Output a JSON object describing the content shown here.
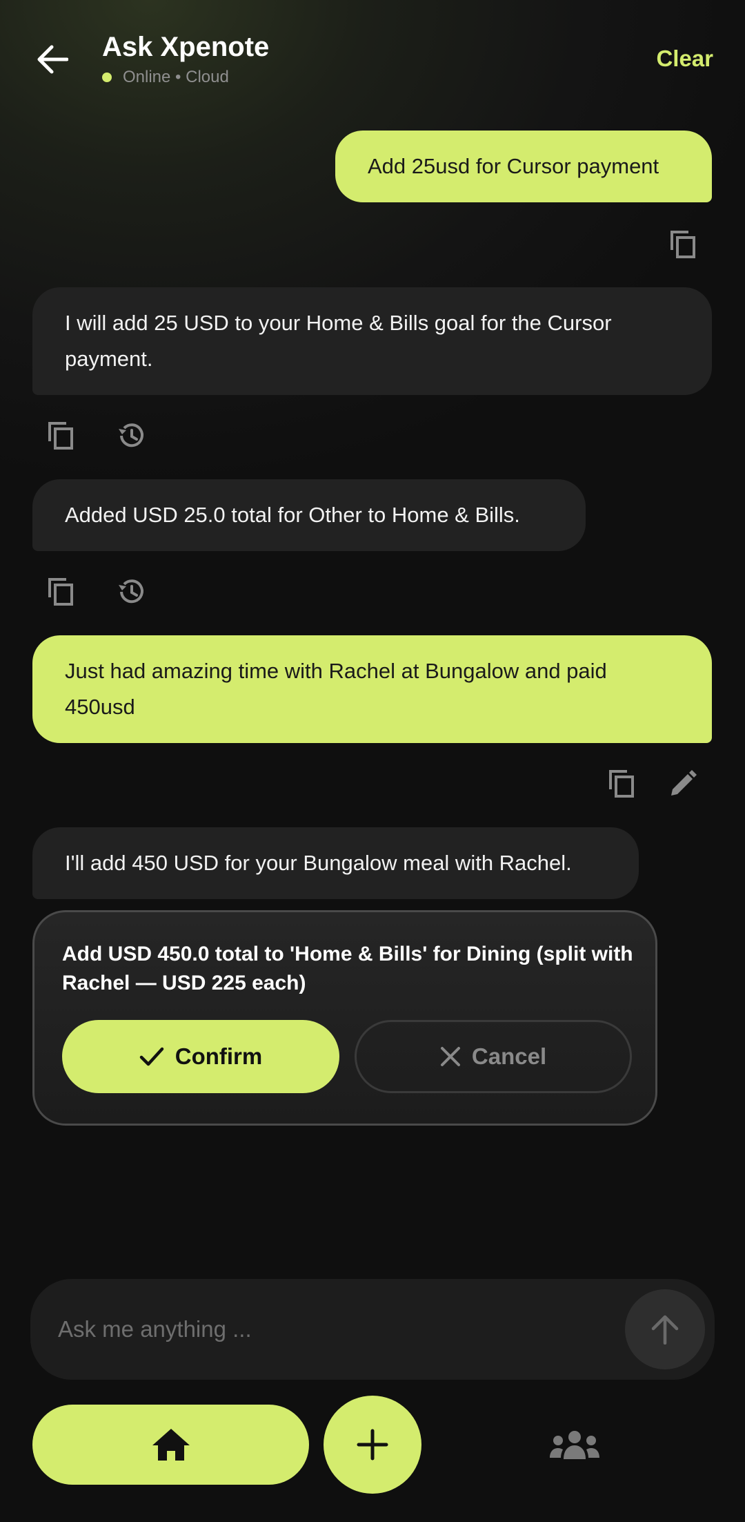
{
  "header": {
    "title": "Ask Xpenote",
    "status": "Online • Cloud",
    "clear_label": "Clear"
  },
  "messages": [
    {
      "role": "user",
      "text": "Add 25usd for Cursor payment"
    },
    {
      "role": "assistant",
      "text": "I will add 25 USD to your Home & Bills goal for the Cursor payment."
    },
    {
      "role": "assistant",
      "text": "Added USD 25.0 total for Other to Home & Bills."
    },
    {
      "role": "user",
      "text": "Just had amazing time with Rachel at Bungalow and paid 450usd"
    },
    {
      "role": "assistant",
      "text": "I'll add 450 USD for your Bungalow meal with Rachel."
    }
  ],
  "confirmation": {
    "text": "Add USD 450.0 total to 'Home & Bills' for Dining (split with Rachel — USD 225 each)",
    "confirm_label": "Confirm",
    "cancel_label": "Cancel"
  },
  "composer": {
    "placeholder": "Ask me anything ..."
  },
  "colors": {
    "accent": "#d4ec6e",
    "background": "#141414",
    "bubble_bot": "#222222"
  },
  "icons": [
    "back-arrow-icon",
    "copy-icon",
    "history-icon",
    "edit-icon",
    "check-icon",
    "close-icon",
    "arrow-up-icon",
    "home-icon",
    "plus-icon",
    "group-icon"
  ]
}
